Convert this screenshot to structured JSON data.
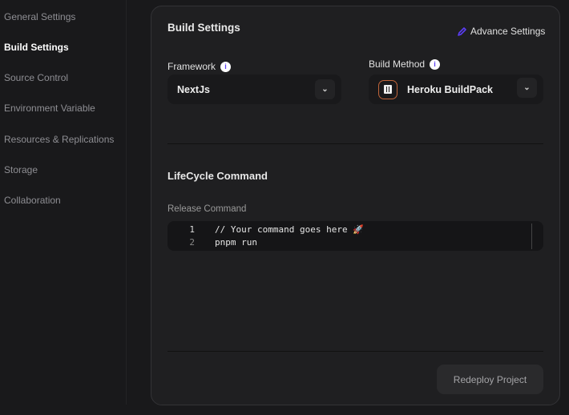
{
  "sidebar": {
    "items": [
      {
        "label": "General Settings"
      },
      {
        "label": "Build Settings",
        "active": true
      },
      {
        "label": "Source Control"
      },
      {
        "label": "Environment Variable"
      },
      {
        "label": "Resources & Replications"
      },
      {
        "label": "Storage"
      },
      {
        "label": "Collaboration"
      }
    ]
  },
  "build": {
    "title": "Build Settings",
    "advance_label": "Advance Settings",
    "framework_label": "Framework",
    "framework_value": "NextJs",
    "method_label": "Build Method",
    "method_value": "Heroku BuildPack",
    "info_glyph": "i"
  },
  "lifecycle": {
    "title": "LifeCycle Command",
    "release_label": "Release Command",
    "lines": [
      {
        "n": "1",
        "text": "// Your command goes here 🚀"
      },
      {
        "n": "2",
        "text": "pnpm run"
      }
    ]
  },
  "footer": {
    "redeploy_label": "Redeploy Project"
  },
  "colors": {
    "accent": "#5b3df5",
    "heroku_border": "#c0643a"
  }
}
